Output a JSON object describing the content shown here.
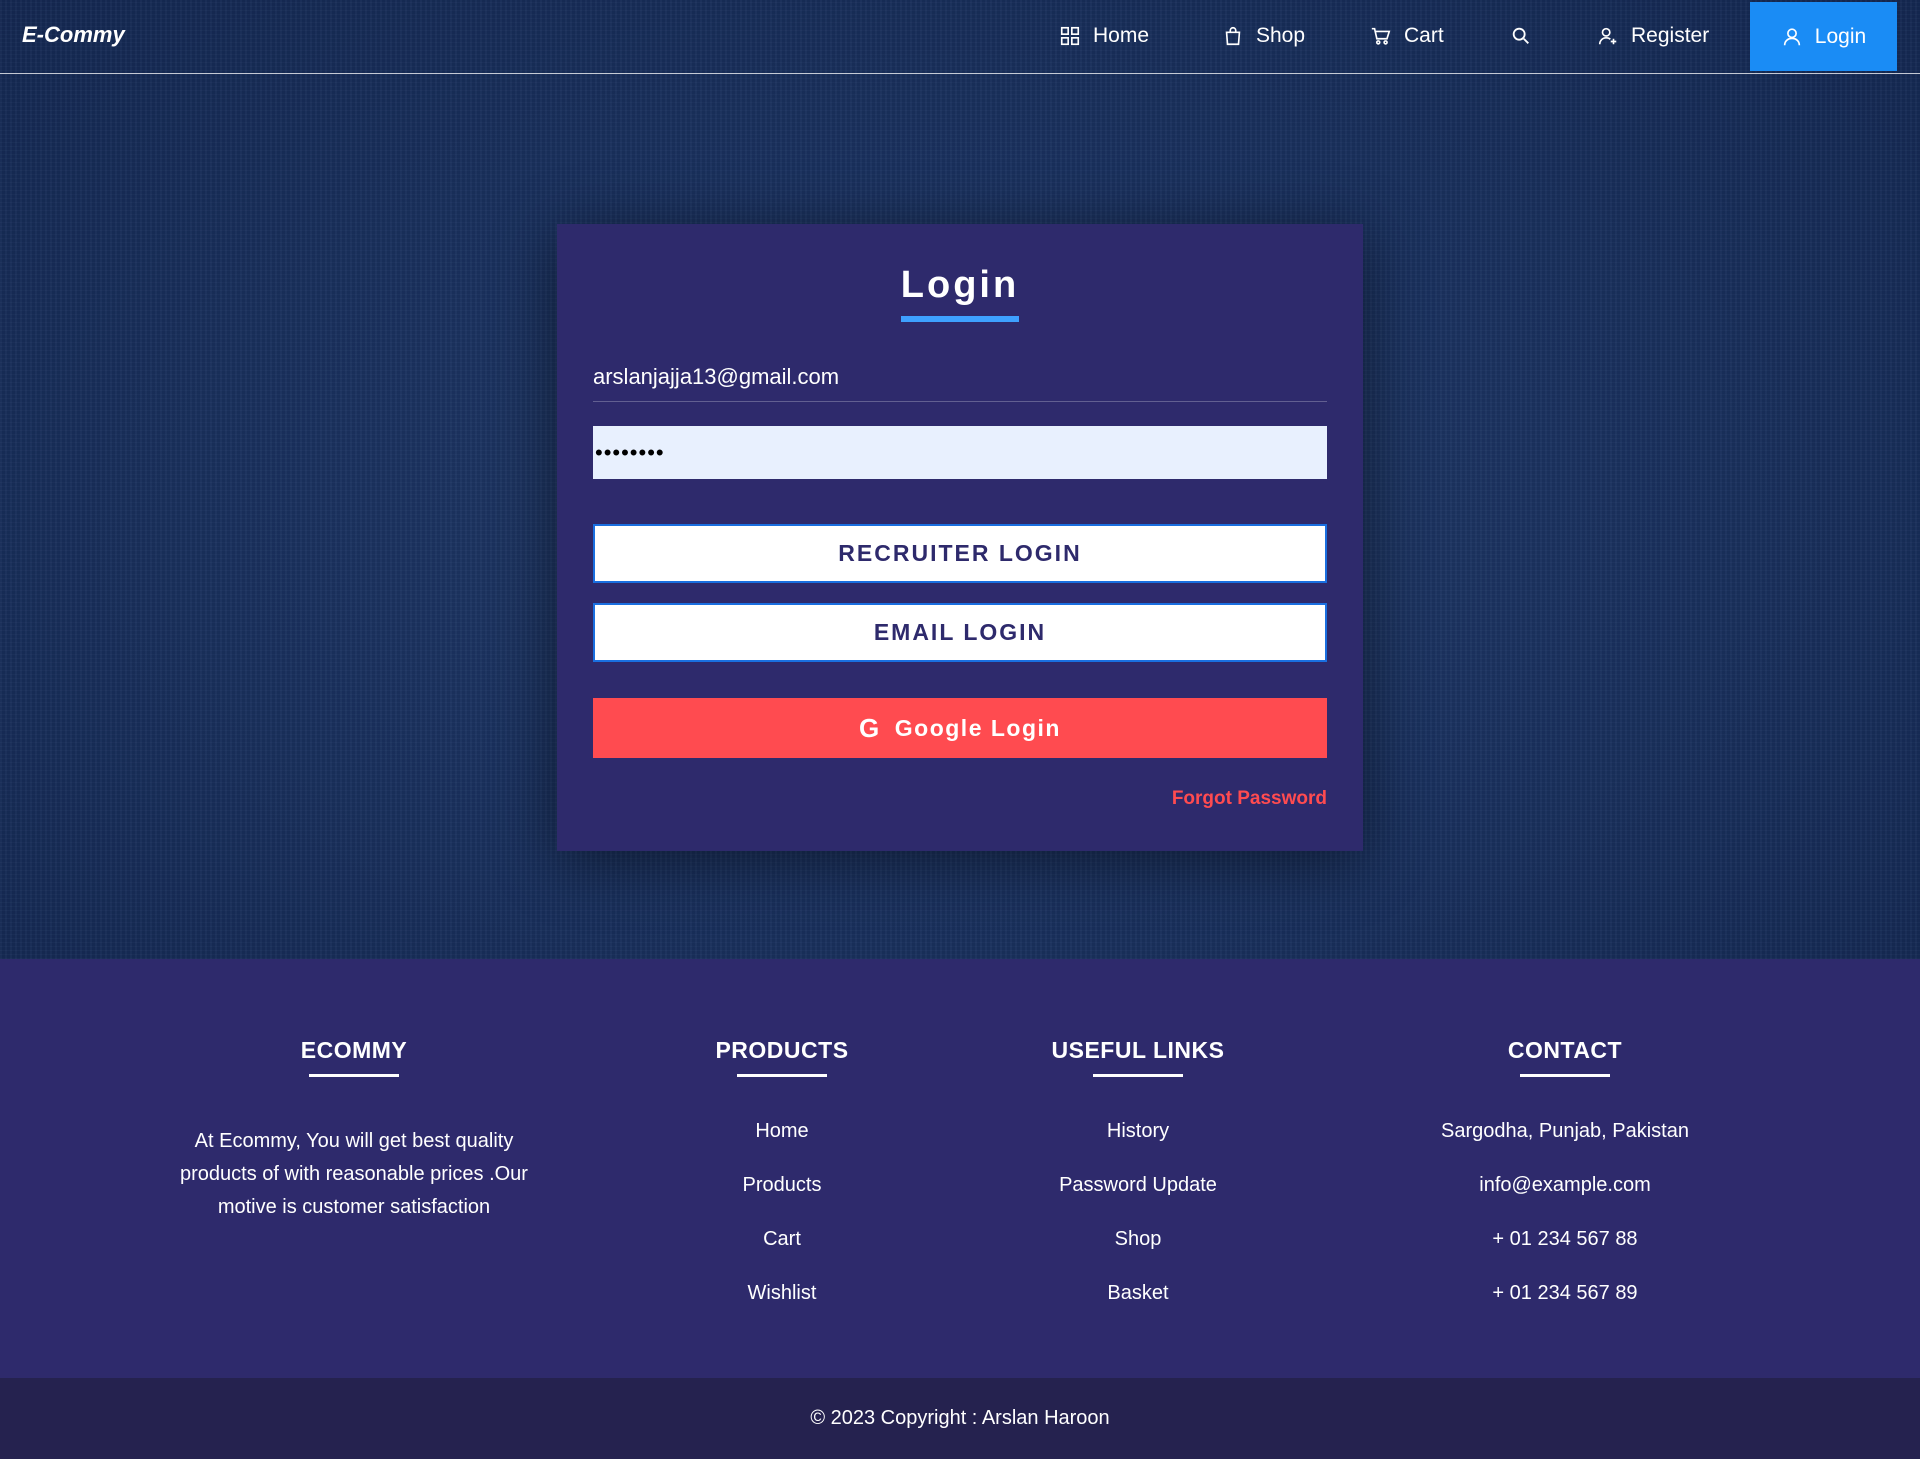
{
  "nav": {
    "brand": "E-Commy",
    "home": "Home",
    "shop": "Shop",
    "cart": "Cart",
    "register": "Register",
    "login": "Login",
    "active_color": "#1a8cf5"
  },
  "login_card": {
    "title": "Login",
    "email_value": "arslanjajja13@gmail.com",
    "password_mask": "••••••••",
    "recruiter_button": "RECRUITER LOGIN",
    "email_button": "EMAIL LOGIN",
    "google_icon": "G",
    "google_button": "Google Login",
    "forgot_password": "Forgot Password",
    "accent_color": "#3ea0ff",
    "google_color": "#ff4b50"
  },
  "footer": {
    "ecommy": {
      "heading": "ECOMMY",
      "description": "At Ecommy, You will get best quality products of with reasonable prices .Our motive is customer satisfaction"
    },
    "products": {
      "heading": "PRODUCTS",
      "links": [
        "Home",
        "Products",
        "Cart",
        "Wishlist"
      ]
    },
    "useful_links": {
      "heading": "USEFUL LINKS",
      "links": [
        "History",
        "Password Update",
        "Shop",
        "Basket"
      ]
    },
    "contact": {
      "heading": "CONTACT",
      "items": [
        "Sargodha, Punjab, Pakistan",
        "info@example.com",
        "+ 01 234 567 88",
        "+ 01 234 567 89"
      ]
    },
    "copyright": "© 2023 Copyright : Arslan Haroon"
  }
}
